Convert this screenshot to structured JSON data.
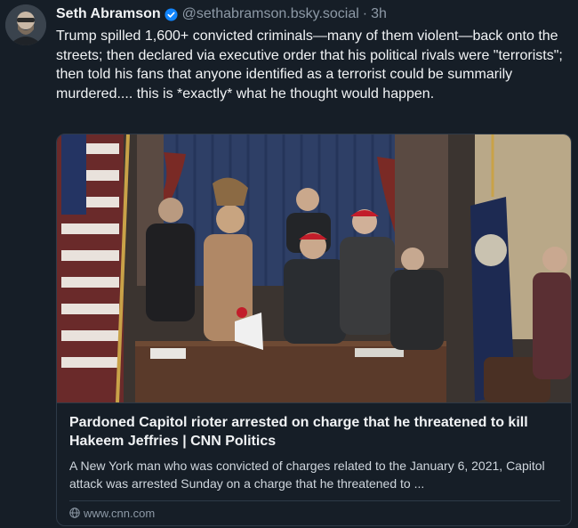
{
  "author": {
    "display_name": "Seth Abramson",
    "handle": "@sethabramson.bsky.social",
    "separator": "·",
    "time": "3h",
    "verified": true,
    "avatar_icon": "avatar-image",
    "verified_icon": "verified-check-icon"
  },
  "post": {
    "text": "Trump spilled 1,600+ convicted criminals—many of them violent—back onto the streets; then declared via executive order that his political rivals were \"terrorists\"; then told his fans that anyone identified as a terrorist could be summarily murdered.... this is *exactly* what he thought would happen."
  },
  "link_card": {
    "image_icon": "news-photo",
    "title": "Pardoned Capitol rioter arrested on charge that he threatened to kill Hakeem Jeffries | CNN Politics",
    "description": "A New York man who was convicted of charges related to the January 6, 2021, Capitol attack was arrested Sunday on a charge that he threatened to ...",
    "domain": "www.cnn.com",
    "domain_icon": "globe-icon"
  },
  "colors": {
    "background": "#161e27",
    "text_primary": "#f1f3f5",
    "text_secondary": "#8d99a6",
    "verified_blue": "#1185fe",
    "card_border": "#2e3a47"
  }
}
